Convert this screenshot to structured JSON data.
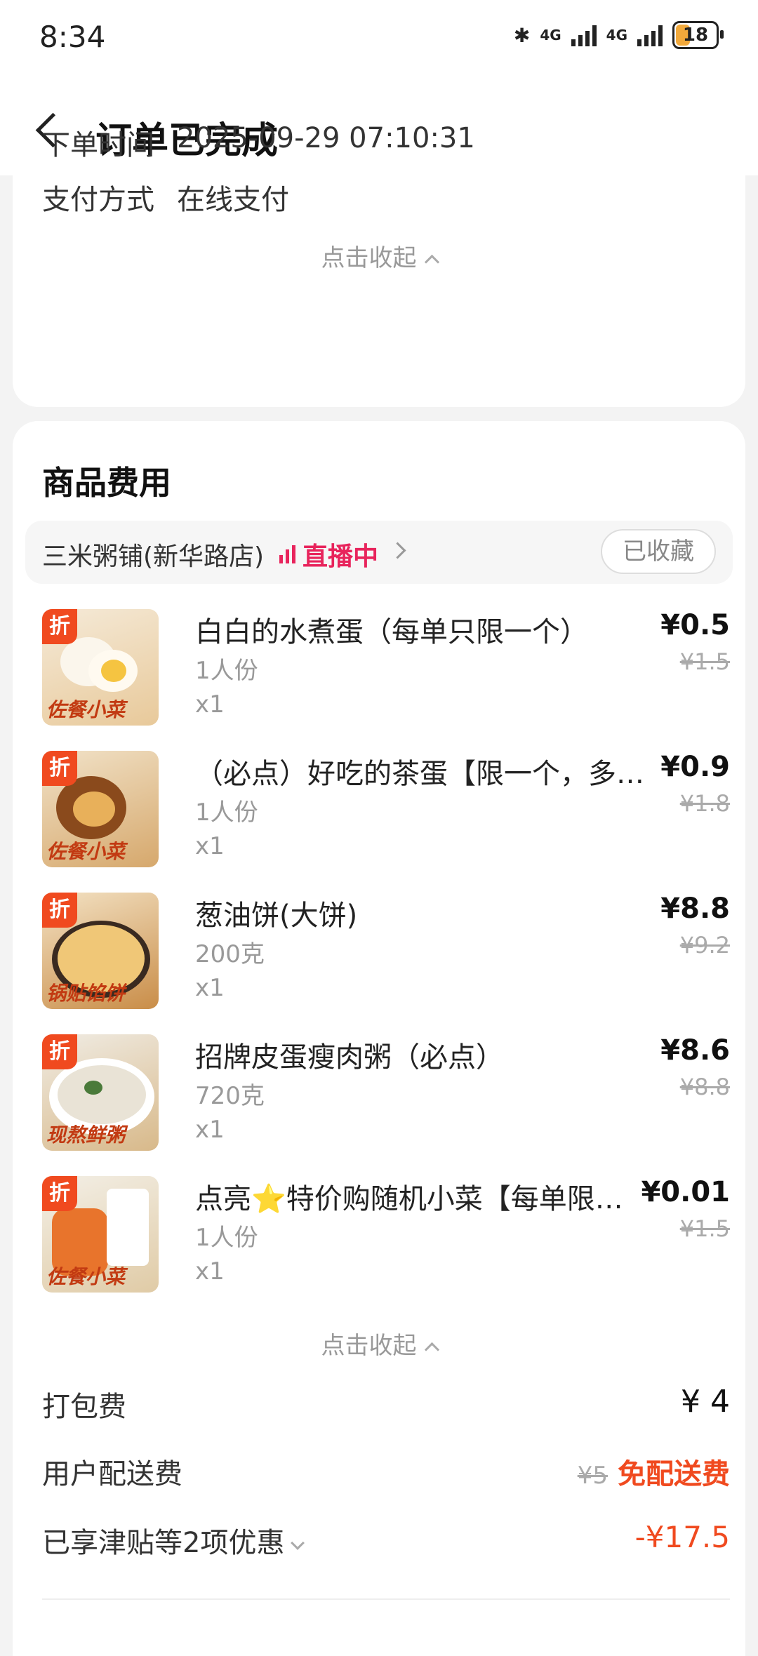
{
  "status_bar": {
    "time": "8:34",
    "battery": "18",
    "net1": "4G",
    "net2": "4G"
  },
  "nav": {
    "title": "订单已完成"
  },
  "order_info": {
    "rows": [
      {
        "label": "下单时间",
        "value": "2025-09-29 07:10:31"
      },
      {
        "label": "支付方式",
        "value": "在线支付"
      }
    ],
    "collapse_label": "点击收起"
  },
  "goods": {
    "section_title": "商品费用",
    "shop_name": "三米粥铺(新华路店)",
    "live_label": "直播中",
    "fav_label": "已收藏",
    "items": [
      {
        "name": "白白的水煮蛋（每单只限一个）",
        "spec": "1人份",
        "qty": "x1",
        "price": "¥0.5",
        "orig": "¥1.5",
        "badge": "折",
        "caption": "佐餐小菜"
      },
      {
        "name": "（必点）好吃的茶蛋【限一个，多…",
        "spec": "1人份",
        "qty": "x1",
        "price": "¥0.9",
        "orig": "¥1.8",
        "badge": "折",
        "caption": "佐餐小菜"
      },
      {
        "name": "葱油饼(大饼)",
        "spec": "200克",
        "qty": "x1",
        "price": "¥8.8",
        "orig": "¥9.2",
        "badge": "折",
        "caption": "锅贴馅饼"
      },
      {
        "name": "招牌皮蛋瘦肉粥（必点）",
        "spec": "720克",
        "qty": "x1",
        "price": "¥8.6",
        "orig": "¥8.8",
        "badge": "折",
        "caption": "现熬鲜粥"
      },
      {
        "name": "点亮⭐特价购随机小菜【每单限…",
        "spec": "1人份",
        "qty": "x1",
        "price": "¥0.01",
        "orig": "¥1.5",
        "badge": "折",
        "caption": "佐餐小菜"
      }
    ],
    "collapse_label": "点击收起"
  },
  "fees": {
    "packing_label": "打包费",
    "packing_value": "¥ 4",
    "delivery_label": "用户配送费",
    "delivery_orig": "¥5",
    "delivery_value": "免配送费",
    "discount_label": "已享津贴等2项优惠",
    "discount_value": "-¥17.5"
  },
  "colors": {
    "accent": "#f04a1f",
    "live": "#e8245c",
    "bg": "#f3f3f3"
  }
}
